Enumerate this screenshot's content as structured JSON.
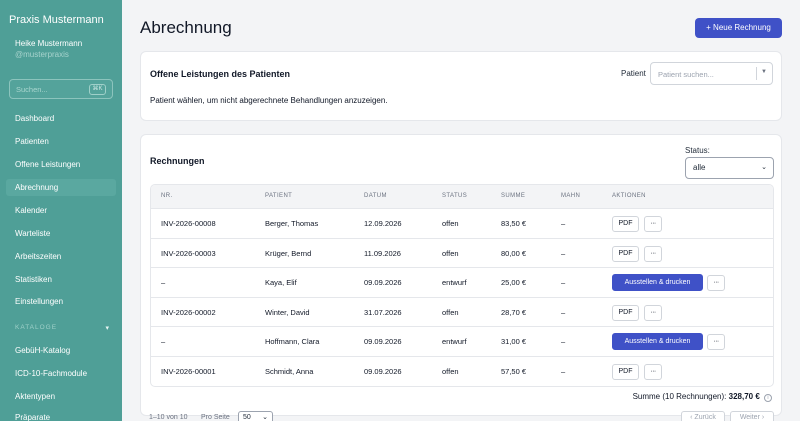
{
  "app": {
    "brand": "Praxis Mustermann",
    "user_name": "Heike Mustermann",
    "user_handle": "@musterpraxis"
  },
  "sidebar": {
    "search_placeholder": "Suchen...",
    "search_shortcut": "⌘K",
    "items": [
      {
        "label": "Dashboard"
      },
      {
        "label": "Patienten"
      },
      {
        "label": "Offene Leistungen"
      },
      {
        "label": "Abrechnung",
        "active": true
      },
      {
        "label": "Kalender"
      },
      {
        "label": "Warteliste"
      },
      {
        "label": "Arbeitszeiten"
      },
      {
        "label": "Statistiken"
      },
      {
        "label": "Einstellungen"
      }
    ],
    "section_label": "KATALOGE",
    "section_items": [
      {
        "label": "GebüH-Katalog"
      },
      {
        "label": "ICD-10-Fachmodule"
      },
      {
        "label": "Aktentypen"
      },
      {
        "label": "Präparate"
      }
    ]
  },
  "header": {
    "title": "Abrechnung",
    "new_invoice_label": "+ Neue Rechnung"
  },
  "open_services": {
    "title": "Offene Leistungen des Patienten",
    "patient_label": "Patient",
    "patient_placeholder": "Patient suchen...",
    "hint": "Patient wählen, um nicht abgerechnete Behandlungen anzuzeigen."
  },
  "invoices": {
    "title": "Rechnungen",
    "status_label": "Status:",
    "status_value": "alle",
    "columns": [
      "NR.",
      "PATIENT",
      "DATUM",
      "STATUS",
      "SUMME",
      "MAHN",
      "AKTIONEN"
    ],
    "rows": [
      {
        "nr": "INV-2026-00008",
        "patient": "Berger, Thomas",
        "datum": "12.09.2026",
        "status": "offen",
        "summe": "83,50 €",
        "mahn": "–",
        "action": "PDF"
      },
      {
        "nr": "INV-2026-00003",
        "patient": "Krüger, Bernd",
        "datum": "11.09.2026",
        "status": "offen",
        "summe": "80,00 €",
        "mahn": "–",
        "action": "PDF"
      },
      {
        "nr": "–",
        "patient": "Kaya, Elif",
        "datum": "09.09.2026",
        "status": "entwurf",
        "summe": "25,00 €",
        "mahn": "–",
        "action": "Ausstellen & drucken"
      },
      {
        "nr": "INV-2026-00002",
        "patient": "Winter, David",
        "datum": "31.07.2026",
        "status": "offen",
        "summe": "28,70 €",
        "mahn": "–",
        "action": "PDF"
      },
      {
        "nr": "–",
        "patient": "Hoffmann, Clara",
        "datum": "09.09.2026",
        "status": "entwurf",
        "summe": "31,00 €",
        "mahn": "–",
        "action": "Ausstellen & drucken"
      },
      {
        "nr": "INV-2026-00001",
        "patient": "Schmidt, Anna",
        "datum": "09.09.2026",
        "status": "offen",
        "summe": "57,50 €",
        "mahn": "–",
        "action": "PDF"
      }
    ],
    "more_label": "···",
    "sum_label": "Summe (10 Rechnungen):",
    "sum_value": "328,70 €",
    "info_icon": "i"
  },
  "pagination": {
    "info": "1–10 von 10",
    "per_page_label": "Pro Seite",
    "per_page_value": "50",
    "prev_label": "‹ Zurück",
    "next_label": "Weiter ›"
  }
}
